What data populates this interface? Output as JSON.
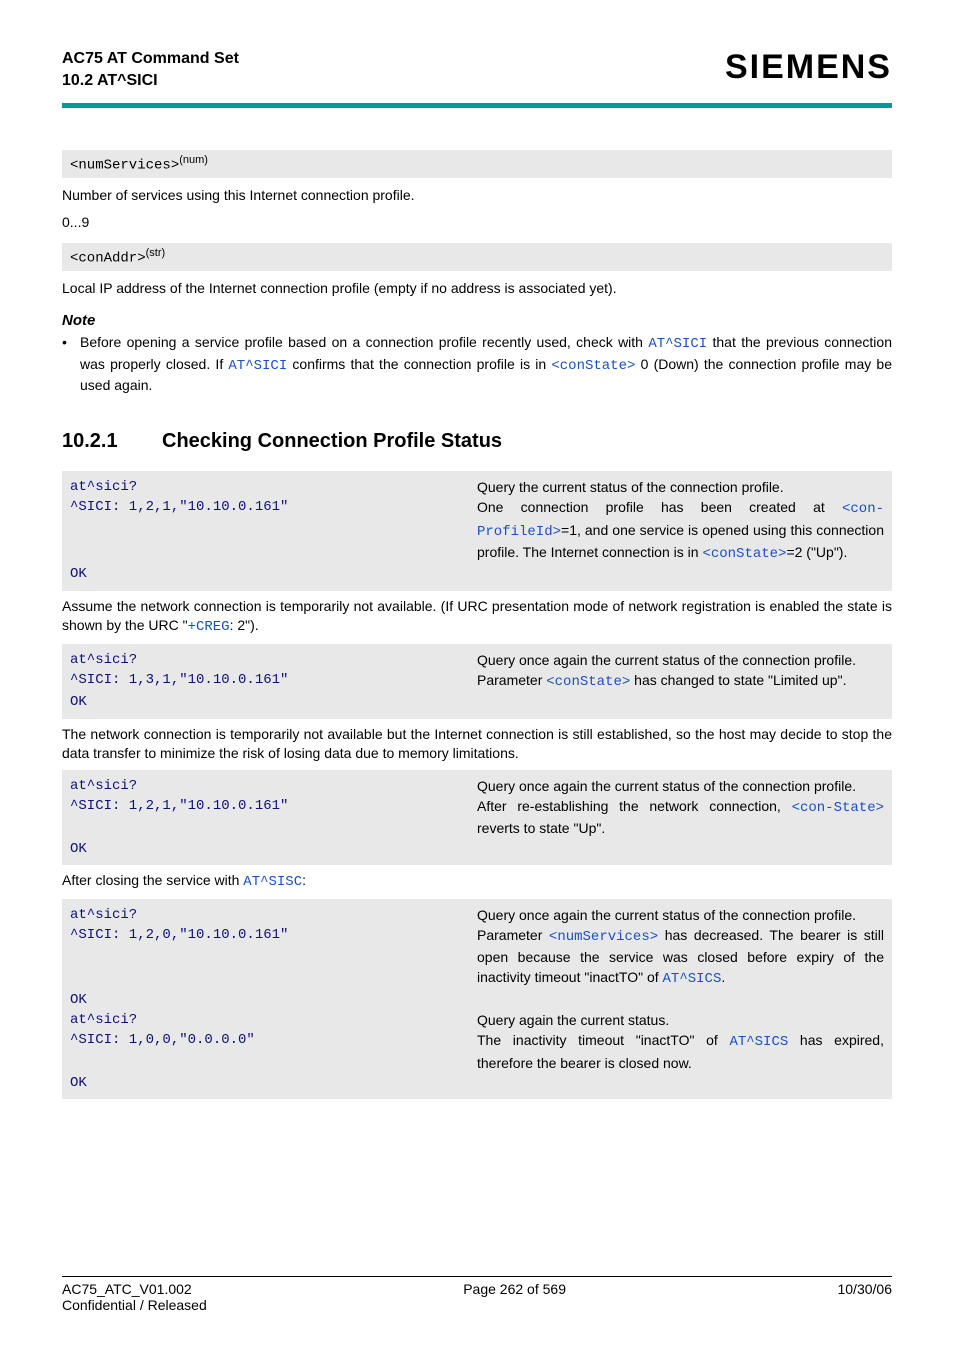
{
  "header": {
    "title": "AC75 AT Command Set",
    "sub": "10.2 AT^SICI",
    "brand": "SIEMENS"
  },
  "param1_name": "<numServices>",
  "param1_sup": "(num)",
  "param1_desc": "Number of services using this Internet connection profile.",
  "param1_range": "0...9",
  "param2_name": "<conAddr>",
  "param2_sup": "(str)",
  "param2_desc": "Local IP address of the Internet connection profile (empty if no address is associated yet).",
  "note_heading": "Note",
  "note_pre": "Before opening a service profile based on a connection profile recently used, check with ",
  "note_link1": "AT^SICI",
  "note_mid1": " that the previous connection was properly closed. If ",
  "note_link2": "AT^SICI",
  "note_mid2": " confirms that the connection profile is in ",
  "note_link3": "<conState>",
  "note_post": " 0 (Down) the connection profile may be used again.",
  "section_num": "10.2.1",
  "section_title": "Checking Connection Profile Status",
  "ex1_l1": "at^sici?",
  "ex1_r1": "Query the current status of the connection profile.",
  "ex1_l2": "^SICI: 1,2,1,\"10.10.0.161\"",
  "ex1_r2a": "One connection profile has been created at ",
  "ex1_r2_link1": "<con-ProfileId>",
  "ex1_r2b": "=1, and one service is opened using this connection profile. The Internet connection is in ",
  "ex1_r2_link2": "<conState>",
  "ex1_r2c": "=2 (\"Up\").",
  "ok": "OK",
  "narr1a": "Assume the network connection is temporarily not available. (If URC presentation mode of network registration is enabled the state is shown by the URC \"",
  "narr1_link": "+CREG",
  "narr1b": ": 2\").",
  "ex2_l1": "at^sici?",
  "ex2_r1": "Query once again the current status of the connection profile.",
  "ex2_l2": "^SICI: 1,3,1,\"10.10.0.161\"",
  "ex2_r2a": "Parameter ",
  "ex2_r2_link": "<conState>",
  "ex2_r2b": " has changed to state \"Limited up\".",
  "narr2": "The network connection is temporarily not available but the Internet connection is still established, so the host may decide to stop the data transfer to minimize the risk of losing data due to memory limitations.",
  "ex3_l1": "at^sici?",
  "ex3_r1": "Query once again the current status of the connection profile.",
  "ex3_l2": "^SICI: 1,2,1,\"10.10.0.161\"",
  "ex3_r2a": "After re-establishing the network connection, ",
  "ex3_r2_link": "<con-State>",
  "ex3_r2b": " reverts to state \"Up\".",
  "narr3a": "After closing the service with ",
  "narr3_link": "AT^SISC",
  "narr3b": ":",
  "ex4_l1": "at^sici?",
  "ex4_r1": "Query once again the current status of the connection profile.",
  "ex4_l2": "^SICI: 1,2,0,\"10.10.0.161\"",
  "ex4_r2a": "Parameter ",
  "ex4_r2_link1": "<numServices>",
  "ex4_r2b": " has decreased. The bearer is still open because the service was closed before expiry of the inactivity timeout \"inactTO\" of ",
  "ex4_r2_link2": "AT^SICS",
  "ex4_r2c": ".",
  "ex4_l3": "at^sici?",
  "ex4_r3": "Query again the current status.",
  "ex4_l4": "^SICI: 1,0,0,\"0.0.0.0\"",
  "ex4_r4a": "The inactivity timeout \"inactTO\" of ",
  "ex4_r4_link": "AT^SICS",
  "ex4_r4b": " has expired, therefore the bearer is closed now.",
  "footer": {
    "left": "AC75_ATC_V01.002",
    "center": "Page 262 of 569",
    "right": "10/30/06",
    "left2": "Confidential / Released"
  }
}
